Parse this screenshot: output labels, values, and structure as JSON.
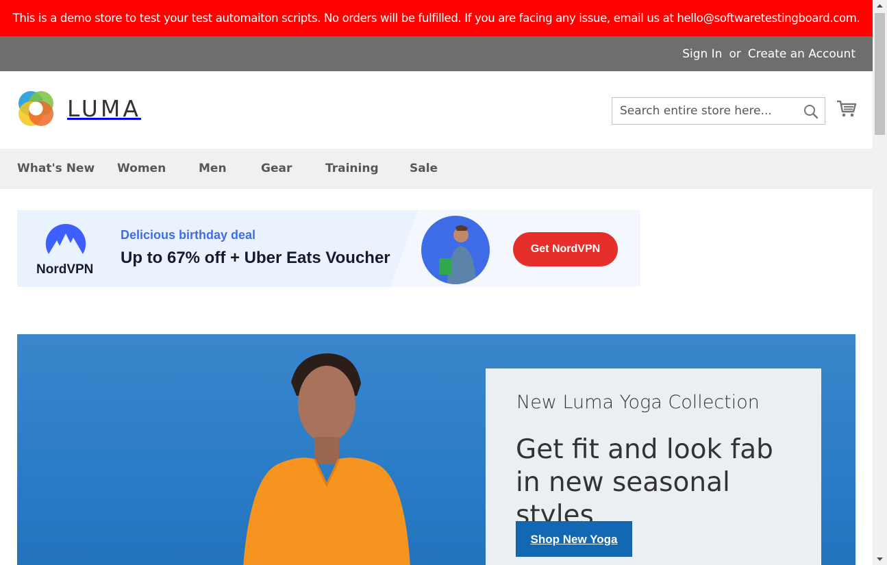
{
  "demo_notice": "This is a demo store to test your test automaiton scripts. No orders will be fulfilled. If you are facing any issue, email us at hello@softwaretestingboard.com.",
  "header": {
    "sign_in": "Sign In",
    "or": "or",
    "create_account": "Create an Account"
  },
  "logo": {
    "text": "LUMA"
  },
  "search": {
    "placeholder": "Search entire store here...",
    "value": ""
  },
  "icons": {
    "search": "search-icon",
    "cart": "cart-icon"
  },
  "nav": {
    "items": [
      {
        "label": "What's New"
      },
      {
        "label": "Women"
      },
      {
        "label": "Men"
      },
      {
        "label": "Gear"
      },
      {
        "label": "Training"
      },
      {
        "label": "Sale"
      }
    ]
  },
  "ad": {
    "brand": "NordVPN",
    "subtitle": "Delicious birthday deal",
    "title": "Up to 67% off + Uber Eats Voucher",
    "cta": "Get NordVPN"
  },
  "hero": {
    "kicker": "New Luma Yoga Collection",
    "title": "Get fit and look fab in new seasonal styles",
    "button": "Shop New Yoga"
  },
  "colors": {
    "demo_banner": "#ff0101",
    "header_bar": "#6e6e6c",
    "nav_bg": "#f0f0f0",
    "primary_button": "#1268b3",
    "ad_cta": "#e62f2a"
  }
}
